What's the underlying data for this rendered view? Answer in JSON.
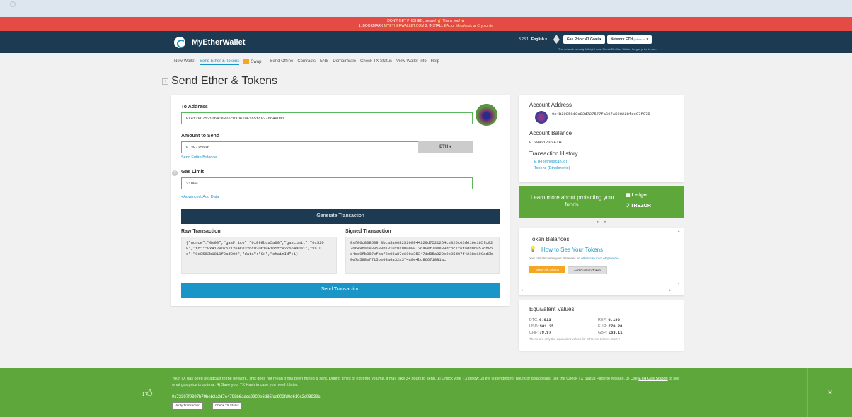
{
  "warning": {
    "line1": "DON'T GET PHISHED, please!",
    "thanks": "Thank you!",
    "line2_pre": "1. BOOKMARK",
    "bookmark_link": "MYETHERWALLET.COM",
    "line2_mid": "2. INSTALL",
    "eal_link": "EAL",
    "or1": "or",
    "metamask_link": "MetaMask",
    "or2": "or",
    "cryptonite_link": "Cryptonite"
  },
  "header": {
    "brand": "MyEtherWallet",
    "version": "3.23.1",
    "language": "English",
    "gas_price": "Gas Price: 41 Gwei",
    "network": "Network ETH",
    "network_provider": "(infura.io)",
    "note": "The network is really full right now. Check Eth Gas Station for gas price to use."
  },
  "nav": [
    "New Wallet",
    "Send Ether & Tokens",
    "Swap",
    "Send Offline",
    "Contracts",
    "ENS",
    "DomainSale",
    "Check TX Status",
    "View Wallet Info",
    "Help"
  ],
  "page_title": "Send Ether & Tokens",
  "form": {
    "to_label": "To Address",
    "to_value": "0x4129D7521264Ce326c03D610E165fc9276649Da1",
    "amount_label": "Amount to Send",
    "amount_value": "0.39735636",
    "currency": "ETH",
    "send_entire": "Send Entire Balance",
    "gas_label": "Gas Limit",
    "gas_value": "21000",
    "advanced": "+Advanced: Add Data",
    "generate": "Generate Transaction",
    "raw_label": "Raw Transaction",
    "raw_value": "{\"nonce\":\"0x00\",\"gasPrice\":\"0x098bca5a00\",\"gasLimit\":\"0x5208\",\"to\":\"0x4129D7521264Ce326c03D610E165fc9276649Da1\",\"value\":\"0x0583b1810f0ad000\",\"data\":\"0x\",\"chainId\":1}",
    "signed_label": "Signed Transaction",
    "signed_value": "0xf86c808509 8bca5a00825208944129d7521264ce326c03d610e165fc9276649da1880583b1810f0ad00080 26a0ef7aee89dcbc7f6fadddd057cb05c4cc0fb087efbaf2b05a87e600a353471d85a020c9c85d07f4238d190ad3b0e7a598ef715be03a6a32a374a8e4bc86671881ac",
    "send": "Send Transaction"
  },
  "account": {
    "address_label": "Account Address",
    "address": "0x4B2985810c83d727577faC07A508228fdeC7f97D",
    "balance_label": "Account Balance",
    "balance_value": "0.39821736",
    "balance_unit": "ETH",
    "history_label": "Transaction History",
    "history_eth": "ETH (etherscan.io)",
    "history_tokens": "Tokens (Ethplorer.io)"
  },
  "ad": {
    "text": "Learn more about protecting your funds.",
    "ledger": "Ledger",
    "trezor": "TREZOR"
  },
  "tokens": {
    "title": "Token Balances",
    "how_to": "How to See Your Tokens",
    "note_pre": "You can also view your Balances on",
    "etherscan": "etherscan.io",
    "or": "or",
    "ethplorer": "ethplorer.io",
    "show_all": "Show All Tokens",
    "add_custom": "Add Custom Token"
  },
  "equivalent": {
    "title": "Equivalent Values",
    "rows": [
      {
        "a_label": "BTC:",
        "a_val": "0.013",
        "b_label": "REP:",
        "b_val": "6.196"
      },
      {
        "a_label": "USD:",
        "a_val": "$81.35",
        "b_label": "EUR:",
        "b_val": "€70.28"
      },
      {
        "a_label": "CHF:",
        "a_val": "79.97",
        "b_label": "GBP:",
        "b_val": "£63.11"
      }
    ],
    "note": "These are only the equivalent values for ETH, not tokens. Sorry!"
  },
  "toast": {
    "text_pre": "Your TX has been broadcast to the network. This does not mean it has been mined & sent. During times of extreme volume, it may take 3+ hours to send. 1) Check your TX below. 2) If it is pending for hours or disappears, use the Check TX Status Page to replace. 3) Use",
    "gas_station": "ETH Gas Station",
    "text_post": "to see what gas price is optimal. 4) Save your TX Hash in case you need it later:",
    "hash": "0x72397f9397b79beb2a3d7e4798b6adcc9900e6d85fce902fd0d610c2c08939c",
    "verify": "Verify Transaction",
    "check": "Check TX Status",
    "close": "×"
  },
  "colors": {
    "header": "#1c3a52",
    "accent": "#1a95c7",
    "success": "#5ea83b",
    "warning": "#e54b45"
  }
}
